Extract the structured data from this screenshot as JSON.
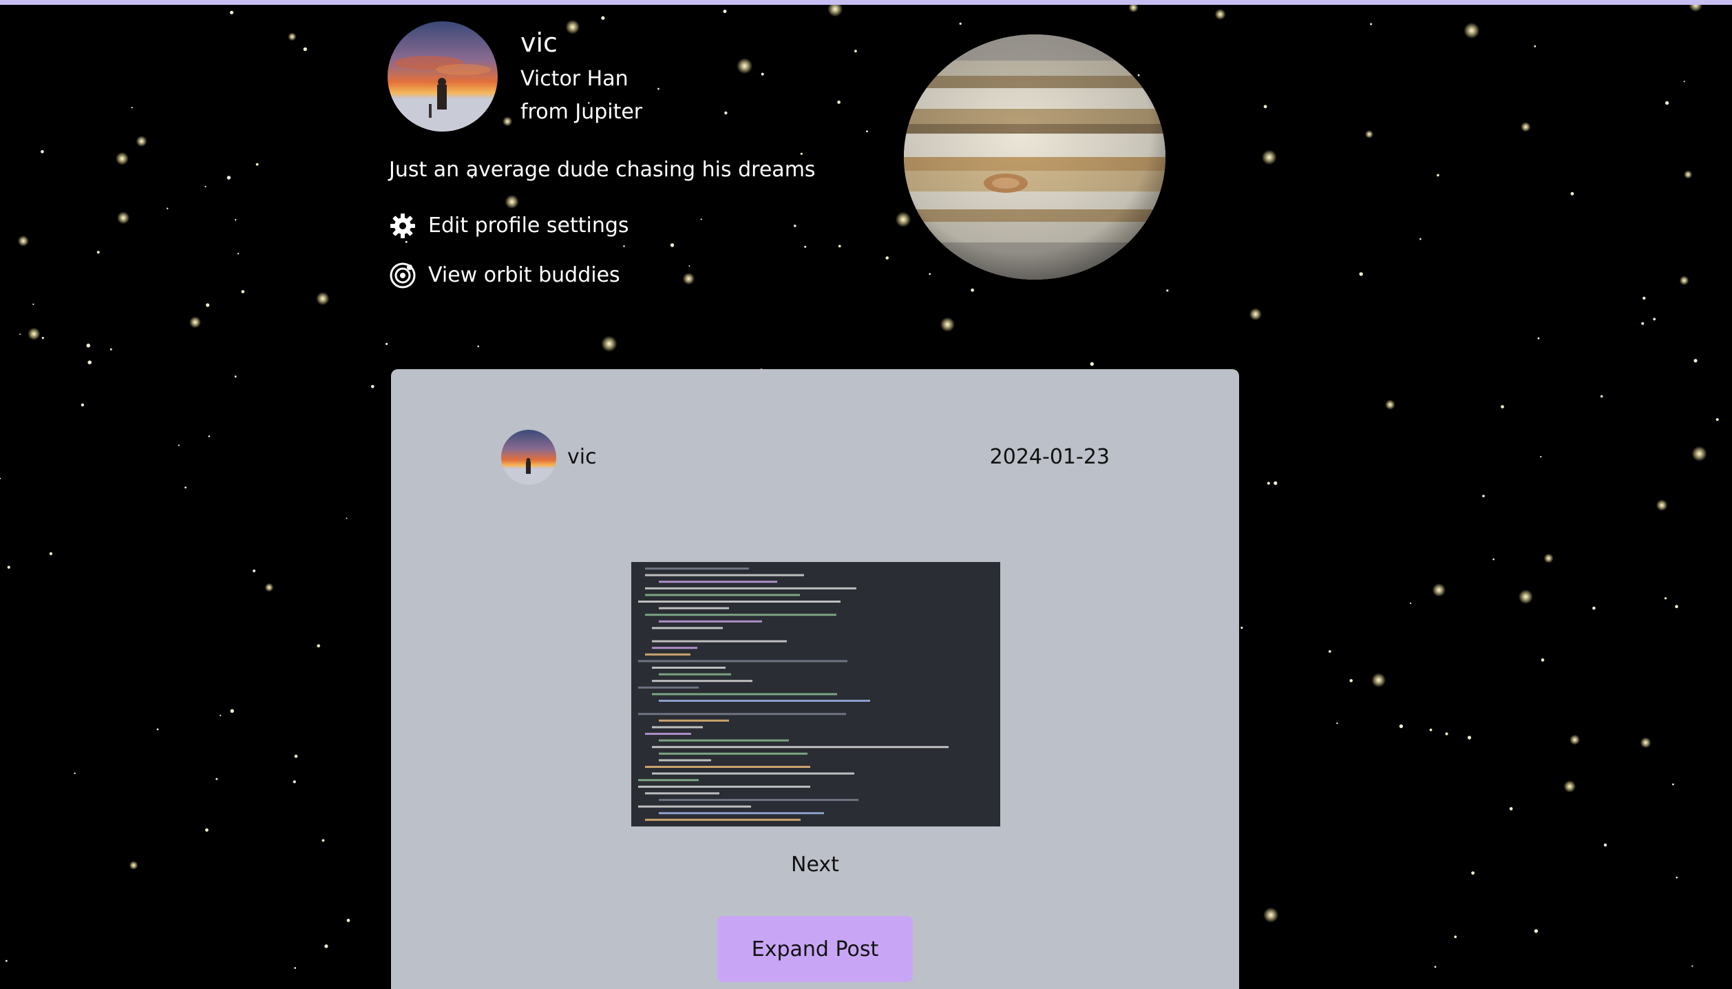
{
  "profile": {
    "username": "vic",
    "full_name": "Victor Han",
    "planet_line": "from Jupiter",
    "bio": "Just an average dude chasing his dreams",
    "edit_settings_label": "Edit profile settings",
    "orbit_buddies_label": "View orbit buddies"
  },
  "post": {
    "author": "vic",
    "date": "2024-01-23",
    "next_label": "Next",
    "expand_label": "Expand Post"
  },
  "colors": {
    "background": "#000000",
    "top_bar": "#c7bff2",
    "card": "#bcc0c8",
    "expand_button": "#c8a6f5"
  }
}
